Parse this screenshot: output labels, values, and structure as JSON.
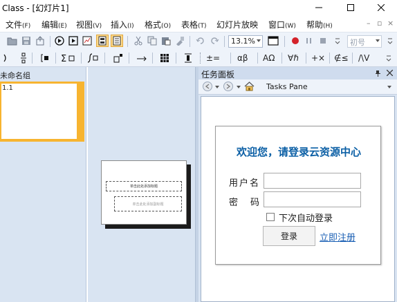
{
  "window": {
    "title": "Class - [幻灯片1]",
    "controls": {
      "minimize": "minimize-icon",
      "maximize": "maximize-icon",
      "close": "close-icon"
    }
  },
  "menubar": {
    "items": [
      {
        "label": "文件",
        "accel": "(F)"
      },
      {
        "label": "编辑",
        "accel": "(E)"
      },
      {
        "label": "视图",
        "accel": "(V)"
      },
      {
        "label": "插入",
        "accel": "(I)"
      },
      {
        "label": "格式",
        "accel": "(O)"
      },
      {
        "label": "表格",
        "accel": "(T)"
      },
      {
        "label": "幻灯片放映",
        "accel": ""
      },
      {
        "label": "窗口",
        "accel": "(W)"
      },
      {
        "label": "帮助",
        "accel": "(H)"
      }
    ]
  },
  "toolbar": {
    "zoom_value": "13.1%",
    "font_size_value": "初号",
    "equation_label": "±=",
    "greek_label": "αβ",
    "symbol_label": "ΑΩ",
    "fx_label": "∀ℏ",
    "math_label": "+×",
    "ineq_label": "∉≤",
    "vec_label": "/\\V"
  },
  "slides_panel": {
    "group_name": "未命名组",
    "slides": [
      {
        "number": "1.1"
      }
    ]
  },
  "slide": {
    "title_placeholder": "单击此处添加标题",
    "subtitle_placeholder": "单击此处添加副标题"
  },
  "task_pane": {
    "title": "任务面板",
    "nav_label": "Tasks Pane",
    "login": {
      "heading": "欢迎您，请登录云资源中心",
      "username_label": "用户名",
      "password_label": "密码",
      "username_value": "",
      "password_value": "",
      "remember_label": "下次自动登录",
      "login_button": "登录",
      "register_link": "立即注册"
    }
  },
  "colors": {
    "accent_blue": "#0b5fa5",
    "selection_orange": "#f7b430",
    "panel_bg": "#d9e4f2",
    "toolbar_bg": "#eef3fa",
    "record_red": "#d4222a"
  }
}
